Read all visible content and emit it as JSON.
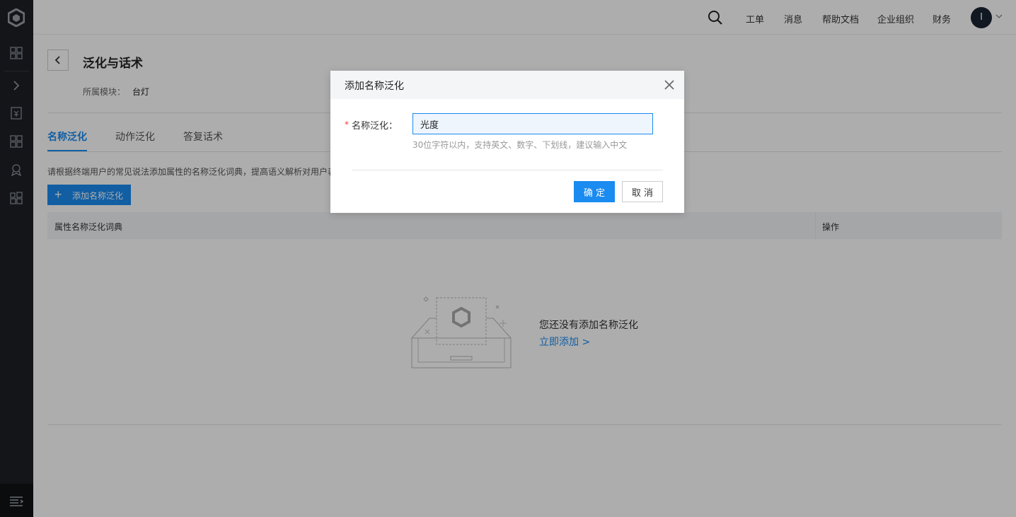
{
  "topbar": {
    "links": [
      "工单",
      "消息",
      "帮助文档",
      "企业组织",
      "财务"
    ],
    "avatar_initial": "I"
  },
  "page": {
    "title": "泛化与话术",
    "module_label": "所属模块：",
    "module_value": "台灯"
  },
  "tabs": [
    {
      "label": "名称泛化",
      "active": true
    },
    {
      "label": "动作泛化",
      "active": false
    },
    {
      "label": "答复话术",
      "active": false
    }
  ],
  "hint": "请根据终端用户的常见说法添加属性的名称泛化词典，提高语义解析对用户表",
  "add_button": "添加名称泛化",
  "table": {
    "columns": [
      "属性名称泛化词典",
      "操作"
    ],
    "rows": []
  },
  "empty_state": {
    "text": "您还没有添加名称泛化",
    "link": "立即添加 >"
  },
  "modal": {
    "title": "添加名称泛化",
    "field_label": "名称泛化：",
    "required_mark": "*",
    "field_value": "光度",
    "help": "30位字符以内，支持英文、数字、下划线，建议输入中文",
    "ok_label": "确 定",
    "cancel_label": "取 消"
  },
  "colors": {
    "accent": "#1a8bf0",
    "sidebar": "#1c2026",
    "required": "#f04134"
  }
}
